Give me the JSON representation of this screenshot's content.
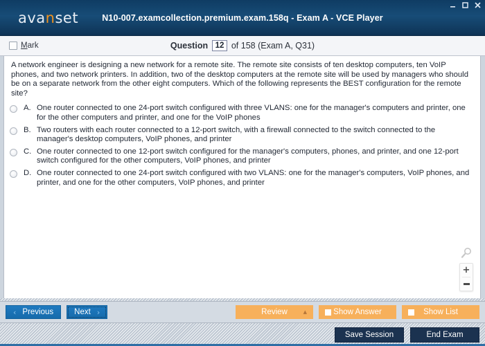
{
  "window": {
    "logo_text_1": "ava",
    "logo_text_accent": "n",
    "logo_text_2": "set",
    "title": "N10-007.examcollection.premium.exam.158q - Exam A - VCE Player",
    "minimize_label": "–",
    "maximize_label": "□",
    "close_label": "✕",
    "titlebar_color": "#164973",
    "accent_color": "#f0921e"
  },
  "question_header": {
    "mark_label_accel": "M",
    "mark_label_rest": "ark",
    "mark_checked": false,
    "question_word": "Question",
    "question_number": "12",
    "of_text": "of 158 (Exam A, Q31)"
  },
  "question": {
    "text": "A network engineer is designing a new network for a remote site. The remote site consists of ten desktop computers, ten VoIP phones, and two network printers. In addition, two of the desktop computers at the remote site will be used by managers who should be on a separate network from the other eight computers. Which of the following represents the BEST configuration for the remote site?",
    "options": [
      {
        "letter": "A.",
        "text": "One router connected to one 24-port switch configured with three VLANS: one for the manager's computers and printer, one for the other computers and printer, and one for the VoIP phones",
        "selected": false
      },
      {
        "letter": "B.",
        "text": "Two routers with each router connected to a 12-port switch, with a firewall connected to the switch connected to the manager's desktop computers, VoIP phones, and printer",
        "selected": false
      },
      {
        "letter": "C.",
        "text": "One router connected to one 12-port switch configured for the manager's computers, phones, and printer, and one 12-port switch configured for the other computers, VoIP phones, and printer",
        "selected": false
      },
      {
        "letter": "D.",
        "text": "One router connected to one 24-port switch configured with two VLANS: one for the manager's computers, VoIP phones, and printer, and one for the other computers, VoIP phones, and printer",
        "selected": false
      }
    ]
  },
  "zoom_widget": {
    "magnifier_icon": "magnifier-icon",
    "zoom_in_label": "+",
    "zoom_out_label": "–"
  },
  "navbar": {
    "previous_label": "Previous",
    "previous_chevron": "‹",
    "next_label": "Next",
    "next_chevron": "›",
    "review_label": "Review",
    "review_caret": "▲",
    "show_answer_label": "Show Answer",
    "show_list_label": "Show List",
    "orange_color": "#f7b05b",
    "blue_color": "#1b74b8"
  },
  "footer": {
    "save_session_label": "Save Session",
    "end_exam_label": "End Exam",
    "dark_color": "#1b3250"
  }
}
